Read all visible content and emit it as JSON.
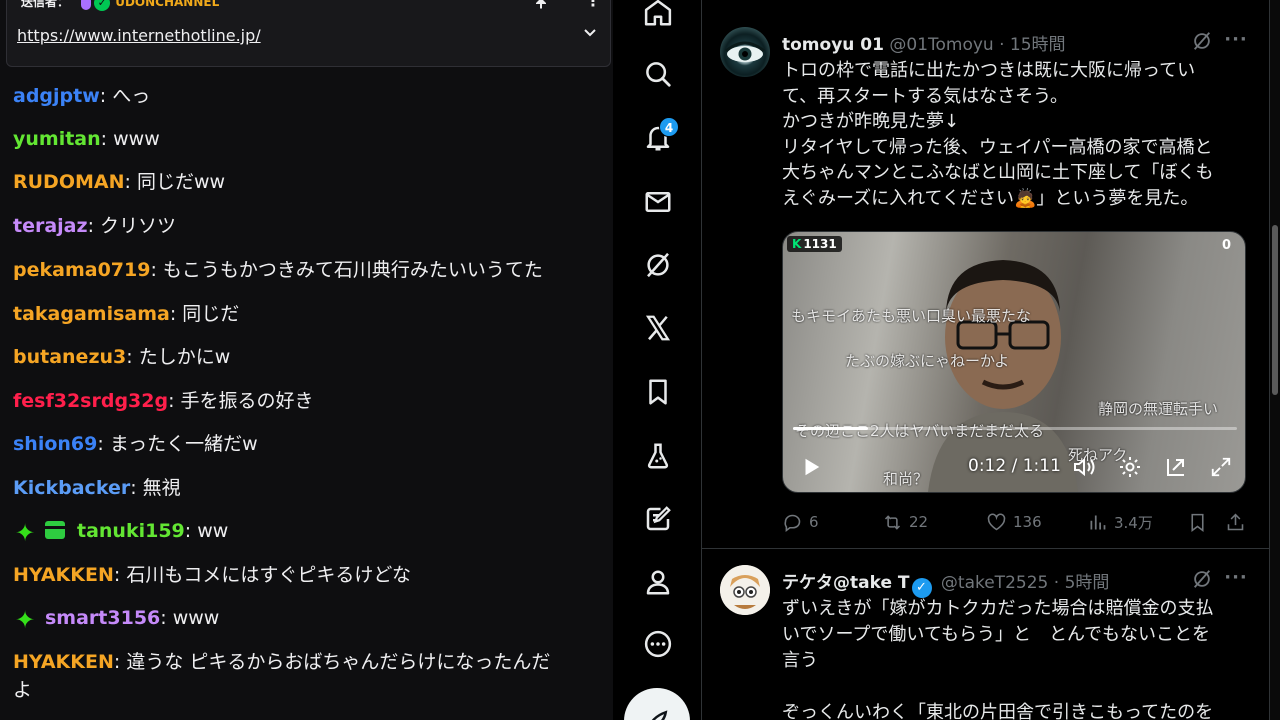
{
  "chat": {
    "pinned": {
      "sender_label": "送信者：",
      "channel": "UDONCHANNEL",
      "link": "https://www.internethotline.jp/"
    },
    "messages": [
      {
        "user": "adgjptw",
        "color": "#3b82f6",
        "text": "へっ"
      },
      {
        "user": "yumitan",
        "color": "#63e633",
        "text": "www"
      },
      {
        "user": "RUDOMAN",
        "color": "#f5a524",
        "text": "同じだww"
      },
      {
        "user": "terajaz",
        "color": "#c58af9",
        "text": "クリソツ"
      },
      {
        "user": "pekama0719",
        "color": "#f5a524",
        "text": "もこうもかつきみて石川典行みたいいうてた"
      },
      {
        "user": "takagamisama",
        "color": "#f5a524",
        "text": "同じだ"
      },
      {
        "user": "butanezu3",
        "color": "#f5a524",
        "text": "たしかにw"
      },
      {
        "user": "fesf32srdg32g",
        "color": "#ff1f4b",
        "text": "手を振るの好き"
      },
      {
        "user": "shion69",
        "color": "#3b82f6",
        "text": "まったく一緒だw"
      },
      {
        "user": "Kickbacker",
        "color": "#5b9cf6",
        "text": "無視"
      },
      {
        "user": "tanuki159",
        "color": "#63e633",
        "text": "ww",
        "emotes": [
          "sparkle-icon",
          "gift-icon"
        ]
      },
      {
        "user": "HYAKKEN",
        "color": "#f5a524",
        "text": "石川もコメにはすぐピキるけどな"
      },
      {
        "user": "smart3156",
        "color": "#c58af9",
        "text": "www",
        "emotes": [
          "sparkle-icon"
        ]
      },
      {
        "user": "HYAKKEN",
        "color": "#f5a524",
        "text": "違うな ピキるからおばちゃんだらけになったんだ",
        "continuation": "よ"
      }
    ]
  },
  "nav": {
    "items": [
      "home-icon",
      "search-icon",
      "notifications-icon",
      "messages-icon",
      "grok-icon",
      "x-premium-icon",
      "bookmarks-icon",
      "lab-icon",
      "articles-icon",
      "profile-icon",
      "more-icon"
    ],
    "notification_count": "4"
  },
  "timeline": {
    "tweet1": {
      "name": "tomoyu 01",
      "handle": "@01Tomoyu",
      "dot": "·",
      "time": "15時間",
      "lines": [
        "トロの枠で電話に出たかつきは既に大阪に帰ってい",
        "て、再スタートする気はなさそう。",
        "かつきが昨晩見た夢↓",
        "リタイヤして帰った後、ウェイパー高橋の家で高橋と",
        "大ちゃんマンとこふなばと山岡に土下座して「ぼくも",
        "えぐみーズに入れてください🙇」という夢を見た。"
      ],
      "video": {
        "views": "1131",
        "views_prefix": "K",
        "corner_count": "0",
        "overlay_lines": [
          "もキモイあたも悪い口臭い最悪たな",
          "たぶの嫁ぶにゃねーかよ",
          "静岡の無運転手い",
          "その辺ここ2人はヤバいまだまだ太る",
          "死ねアク",
          "和尚？"
        ],
        "timecode": "0:12 / 1:11",
        "progress": 0.17
      },
      "replies": "6",
      "reposts": "22",
      "likes": "136",
      "views": "3.4万"
    },
    "tweet2": {
      "name": "テケタ@take T",
      "handle": "@takeT2525",
      "dot": "·",
      "time": "5時間",
      "lines": [
        "ずいえきが「嫁がカトクカだった場合は賠償金の支払",
        "いでソープで働いてもらう」と　とんでもないことを",
        "言う",
        "",
        "ぞっくんいわく「東北の片田舎で引きこもってたのを"
      ]
    }
  }
}
